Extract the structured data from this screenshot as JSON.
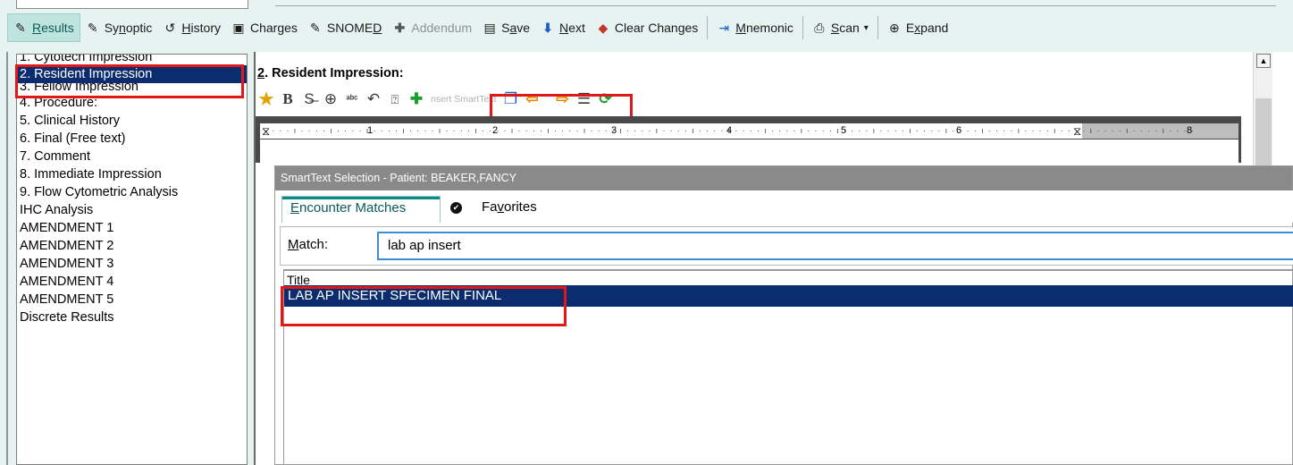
{
  "toolbar": {
    "items": [
      {
        "label_pre": "",
        "label_ul": "R",
        "label_post": "esults",
        "icon": "pencil-icon"
      },
      {
        "label_pre": "Sy",
        "label_ul": "n",
        "label_post": "optic",
        "icon": "pencil-icon"
      },
      {
        "label_pre": "",
        "label_ul": "H",
        "label_post": "istory",
        "icon": "history-icon"
      },
      {
        "label_pre": "Charges",
        "label_ul": "",
        "label_post": "",
        "icon": "charges-icon"
      },
      {
        "label_pre": "SNOME",
        "label_ul": "D",
        "label_post": "",
        "icon": "pencil-icon"
      },
      {
        "label_pre": "Addendum",
        "label_ul": "",
        "label_post": "",
        "icon": "plus-icon"
      },
      {
        "label_pre": "S",
        "label_ul": "a",
        "label_post": "ve",
        "icon": "save-icon"
      },
      {
        "label_pre": "",
        "label_ul": "N",
        "label_post": "ext",
        "icon": "arrow-down-icon"
      },
      {
        "label_pre": "Clear Chan",
        "label_ul": "g",
        "label_post": "es",
        "icon": "eraser-icon"
      },
      {
        "label_pre": "",
        "label_ul": "M",
        "label_post": "nemonic",
        "icon": "mnemonic-icon"
      },
      {
        "label_pre": "",
        "label_ul": "S",
        "label_post": "can",
        "icon": "scan-icon"
      },
      {
        "label_pre": "E",
        "label_ul": "x",
        "label_post": "pand",
        "icon": "expand-icon"
      }
    ]
  },
  "sections": {
    "items": [
      "1. Cytotech Impression",
      "2. Resident Impression",
      "3. Fellow Impression",
      "4. Procedure:",
      "5. Clinical History",
      "6. Final (Free text)",
      "7. Comment",
      "8. Immediate Impression",
      "9. Flow Cytometric Analysis",
      "IHC Analysis",
      "AMENDMENT 1",
      "AMENDMENT 2",
      "AMENDMENT 3",
      "AMENDMENT 4",
      "AMENDMENT 5",
      "Discrete Results"
    ]
  },
  "editor": {
    "section_title_ul": "2",
    "section_title_rest": ". Resident Impression:",
    "smarttext_label": "nsert SmartText",
    "ruler_numbers": [
      "1",
      "2",
      "3",
      "4",
      "5",
      "6",
      "8"
    ]
  },
  "dialog": {
    "title": "SmartText Selection - Patient:  BEAKER,FANCY",
    "tab_encounter_ul": "E",
    "tab_encounter_rest": "ncounter Matches",
    "tab_favorites_pre": "Fa",
    "tab_favorites_ul": "v",
    "tab_favorites_post": "orites",
    "match_label_ul": "M",
    "match_label_rest": "atch:",
    "match_value": "lab ap insert",
    "column_title": "Title",
    "result_row": "LAB AP INSERT SPECIMEN FINAL"
  },
  "colors": {
    "selection": "#0b2c6e",
    "highlight_box": "#e01818",
    "accent": "#0a8a85"
  }
}
